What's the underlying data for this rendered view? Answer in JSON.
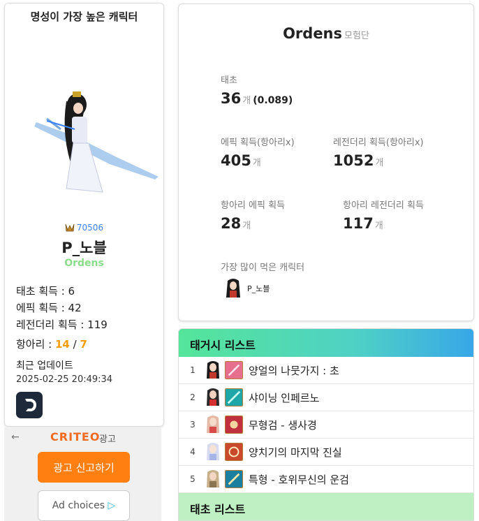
{
  "character_card": {
    "heading": "명성이 가장 높은 캐릭터",
    "fame": "70506",
    "name": "P_노블",
    "guild": "Ordens",
    "stats": [
      "태초 획득 : 6",
      "에픽 획득 : 42",
      "레전더리 획득 : 119"
    ],
    "hang_label": "항아리 : ",
    "hang_a": "14",
    "hang_sep": " / ",
    "hang_b": "7",
    "update_label": "최근 업데이트",
    "update_time": "2025-02-25 20:49:34"
  },
  "ad": {
    "back": "←",
    "brand": "CRITEO",
    "word": "광고",
    "report": "광고 신고하기",
    "choices": "Ad choices"
  },
  "adventure": {
    "name": "Ordens",
    "sub": "모험단",
    "taecho_label": "태초",
    "taecho_value": "36",
    "taecho_unit": "개",
    "taecho_ratio": "(0.089)",
    "epic_label": "에픽 획득(항아리x)",
    "epic_value": "405",
    "legend_label": "레전더리 획득(항아리x)",
    "legend_value": "1052",
    "hang_epic_label": "항아리 에픽 획득",
    "hang_epic_value": "28",
    "hang_legend_label": "항아리 레전더리 획득",
    "hang_legend_value": "117",
    "unit": "개",
    "most_label": "가장 많이 먹은 캐릭터",
    "most_name": "P_노블"
  },
  "taegeosi": {
    "title": "태거시 리스트",
    "rows": [
      {
        "num": "1",
        "name": "양얼의 나뭇가지 : 초"
      },
      {
        "num": "2",
        "name": "샤이닝 인페르노"
      },
      {
        "num": "3",
        "name": "무형검 - 생사경"
      },
      {
        "num": "4",
        "name": "양치기의 마지막 진실"
      },
      {
        "num": "5",
        "name": "특형 - 호위무신의 운검"
      }
    ],
    "next_title": "태초 리스트"
  }
}
